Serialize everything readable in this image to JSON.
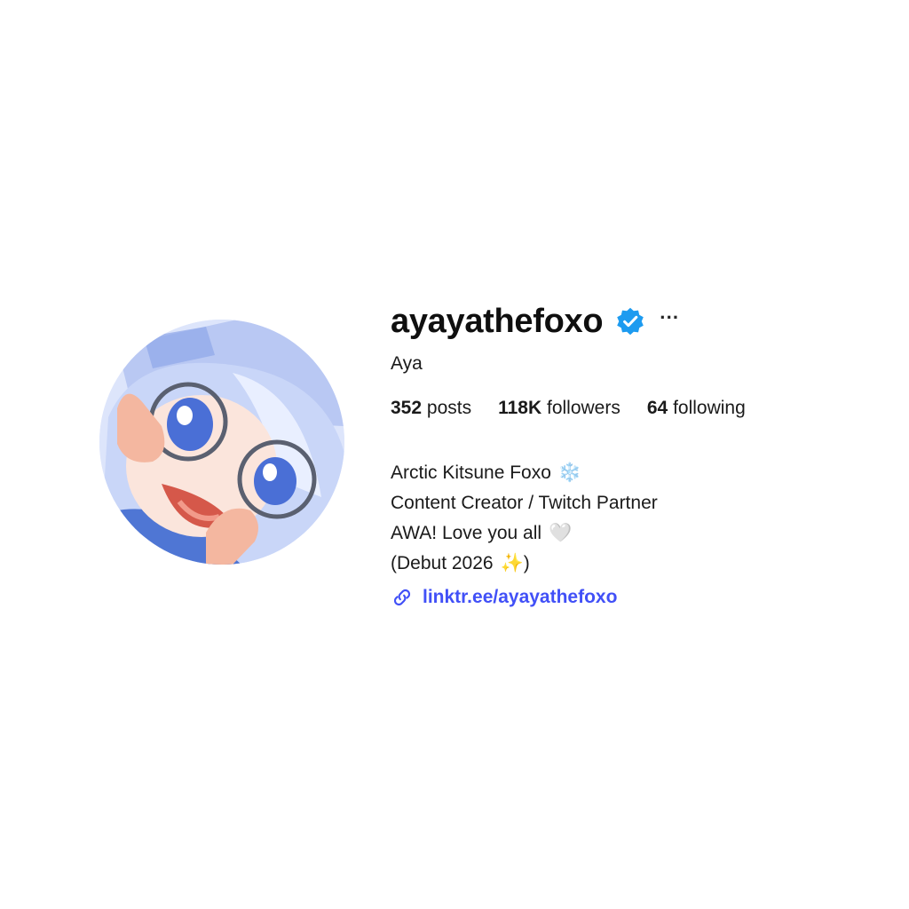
{
  "profile": {
    "username": "ayayathefoxo",
    "display_name": "Aya",
    "verified": true,
    "more_label": "···",
    "stats": {
      "posts_count": "352",
      "posts_label": "posts",
      "followers_count": "118K",
      "followers_label": "followers",
      "following_count": "64",
      "following_label": "following"
    },
    "bio": {
      "line1_text": "Arctic Kitsune Foxo",
      "line1_emoji": "❄️",
      "line2_text": "Content Creator / Twitch Partner",
      "line3_text": "AWA! Love you all",
      "line3_emoji": "🤍",
      "line4_prefix": "(Debut 2026",
      "line4_emoji": "✨",
      "line4_suffix": ")"
    },
    "link": {
      "text": "linktr.ee/ayayathefoxo",
      "icon": "link-icon"
    }
  },
  "colors": {
    "verified_badge": "#1d9bf0",
    "link": "#4150f7"
  },
  "icons": {
    "verified": "verified-badge-icon",
    "more": "more-options-icon",
    "link": "link-icon"
  }
}
